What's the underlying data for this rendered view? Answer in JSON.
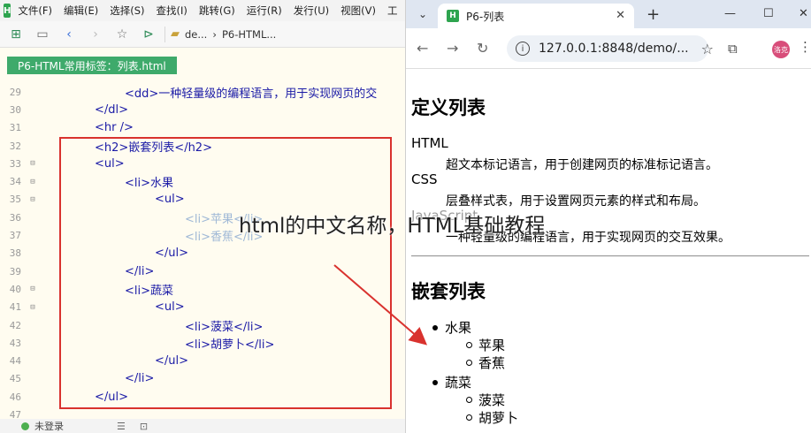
{
  "editor": {
    "menu": [
      "文件(F)",
      "编辑(E)",
      "选择(S)",
      "查找(I)",
      "跳转(G)",
      "运行(R)",
      "发行(U)",
      "视图(V)",
      "工"
    ],
    "breadcrumb": [
      "de...",
      "P6-HTML..."
    ],
    "file_tab": "P6-HTML常用标签：列表.html",
    "lines": [
      {
        "n": "29",
        "code": "<dd>一种轻量级的编程语言，用于实现网页的交"
      },
      {
        "n": "30",
        "code": "</dl>"
      },
      {
        "n": "31",
        "code": "<hr />"
      },
      {
        "n": "32",
        "code": "<h2>嵌套列表</h2>"
      },
      {
        "n": "33",
        "code": "<ul>"
      },
      {
        "n": "34",
        "code": "<li>水果"
      },
      {
        "n": "35",
        "code": "<ul>"
      },
      {
        "n": "36",
        "code": "<li>苹果</li>"
      },
      {
        "n": "37",
        "code": "<li>香蕉</li>"
      },
      {
        "n": "38",
        "code": "</ul>"
      },
      {
        "n": "39",
        "code": "</li>"
      },
      {
        "n": "40",
        "code": "<li>蔬菜"
      },
      {
        "n": "41",
        "code": "<ul>"
      },
      {
        "n": "42",
        "code": "<li>菠菜</li>"
      },
      {
        "n": "43",
        "code": "<li>胡萝卜</li>"
      },
      {
        "n": "44",
        "code": "</ul>"
      },
      {
        "n": "45",
        "code": "</li>"
      },
      {
        "n": "46",
        "code": "</ul>"
      },
      {
        "n": "47",
        "code": ""
      }
    ],
    "status": "未登录"
  },
  "browser": {
    "tab_title": "P6-列表",
    "url": "127.0.0.1:8848/demo/...",
    "avatar_text": "洛克",
    "page": {
      "heading1": "定义列表",
      "dl": [
        {
          "term": "HTML",
          "desc": "超文本标记语言，用于创建网页的标准标记语言。"
        },
        {
          "term": "CSS",
          "desc": "层叠样式表，用于设置网页元素的样式和布局。"
        },
        {
          "term": "JavaScript",
          "desc": "一种轻量级的编程语言，用于实现网页的交互效果。"
        }
      ],
      "heading2": "嵌套列表",
      "nested": [
        {
          "label": "水果",
          "children": [
            "苹果",
            "香蕉"
          ]
        },
        {
          "label": "蔬菜",
          "children": [
            "菠菜",
            "胡萝卜"
          ]
        }
      ]
    }
  },
  "watermark": "html的中文名称，HTML基础教程",
  "colors": {
    "accent_green": "#3eaa6b",
    "annotation_red": "#d9322e",
    "tag_blue": "#1a1aa6"
  }
}
